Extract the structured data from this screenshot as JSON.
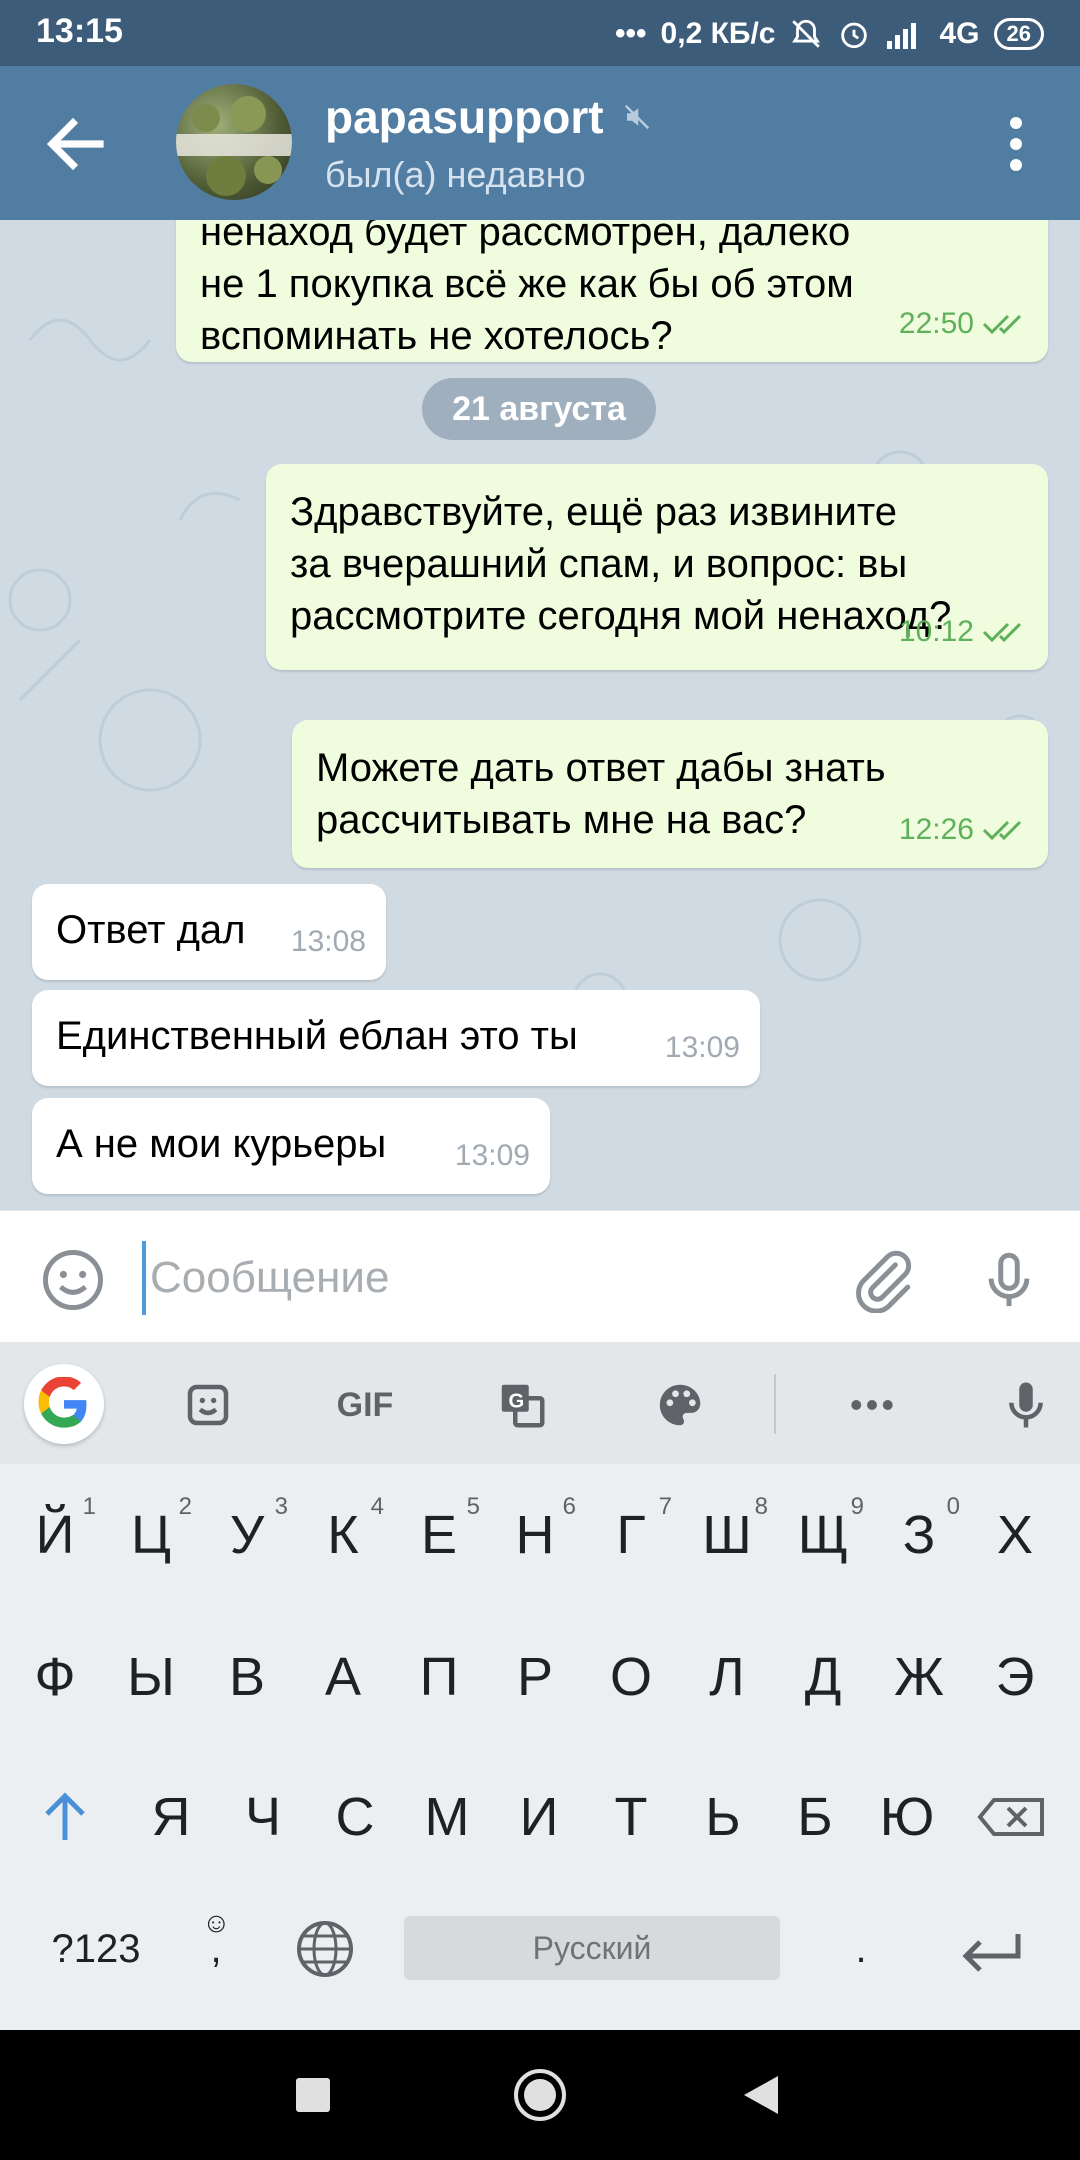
{
  "status_bar": {
    "time": "13:15",
    "network_speed": "0,2 КБ/с",
    "network_type": "4G",
    "battery": "26",
    "icons": [
      "dots-icon",
      "mute-bell-icon",
      "alarm-icon",
      "signal-icon",
      "battery-icon"
    ]
  },
  "header": {
    "title": "papasupport",
    "status": "был(а) недавно",
    "icons": [
      "back-arrow-icon",
      "avatar",
      "muted-icon",
      "more-vert-icon"
    ]
  },
  "messages": [
    {
      "direction": "out",
      "text_line1": "ненаход будет рассмотрен, далеко",
      "text_line2": "не 1 покупка всё же как бы об этом",
      "text_line3": "вспоминать не хотелось?",
      "time": "22:50",
      "status": "read"
    },
    {
      "direction": "out",
      "text_line1": "Здравствуйте, ещё раз извините",
      "text_line2": "за вчерашний спам, и вопрос: вы",
      "text_line3": "рассмотрите сегодня мой ненаход?",
      "time": "10:12",
      "status": "read"
    },
    {
      "direction": "out",
      "text_line1": "Можете дать ответ дабы знать",
      "text_line2": "рассчитывать мне на вас?",
      "time": "12:26",
      "status": "read"
    },
    {
      "direction": "in",
      "text": "Ответ дал",
      "time": "13:08"
    },
    {
      "direction": "in",
      "text": "Единственный еблан это ты",
      "time": "13:09"
    },
    {
      "direction": "in",
      "text": "А не мои курьеры",
      "time": "13:09"
    }
  ],
  "date_separator": "21 августа",
  "input": {
    "placeholder": "Сообщение",
    "value": ""
  },
  "keyboard": {
    "toolbar": [
      "google-icon",
      "sticker-icon",
      "GIF",
      "translate-icon",
      "palette-icon",
      "more-icon",
      "mic-icon"
    ],
    "gif_label": "GIF",
    "google_label": "G",
    "row1": [
      "Й",
      "Ц",
      "У",
      "К",
      "Е",
      "Н",
      "Г",
      "Ш",
      "Щ",
      "З",
      "Х"
    ],
    "row1_hints": [
      "1",
      "2",
      "3",
      "4",
      "5",
      "6",
      "7",
      "8",
      "9",
      "0",
      ""
    ],
    "row2": [
      "Ф",
      "Ы",
      "В",
      "А",
      "П",
      "Р",
      "О",
      "Л",
      "Д",
      "Ж",
      "Э"
    ],
    "row3": [
      "Я",
      "Ч",
      "С",
      "М",
      "И",
      "Т",
      "Ь",
      "Б",
      "Ю"
    ],
    "symbols_key": "?123",
    "comma_key": ",",
    "space_label": "Русский",
    "period_key": "."
  },
  "colors": {
    "header": "#527da3",
    "status_bar": "#3d5c7a",
    "outgoing_bubble": "#effdde",
    "incoming_bubble": "#ffffff",
    "read_check": "#5fb05a"
  }
}
